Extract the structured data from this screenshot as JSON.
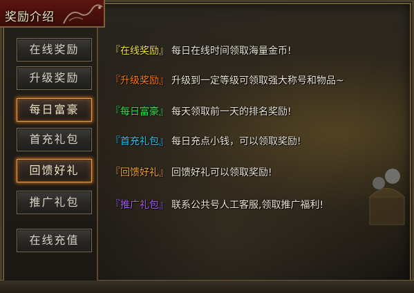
{
  "window": {
    "title": "奖励介绍"
  },
  "menu": [
    {
      "label": "在线奖励",
      "highlighted": false
    },
    {
      "label": "升级奖励",
      "highlighted": false
    },
    {
      "label": "每日富豪",
      "highlighted": true
    },
    {
      "label": "首充礼包",
      "highlighted": false
    },
    {
      "label": "回馈好礼",
      "highlighted": true
    },
    {
      "label": "推广礼包",
      "highlighted": false
    },
    {
      "label": "在线充值",
      "highlighted": false
    }
  ],
  "rewards": [
    {
      "tag": "『在线奖励』",
      "tag_color": "#f2e23a",
      "desc": "每日在线时间领取海量金币!"
    },
    {
      "tag": "『升级奖励』",
      "tag_color": "#ff7a12",
      "desc": "升级到一定等级可领取强大称号和物品~"
    },
    {
      "tag": "『每日富豪』",
      "tag_color": "#39e24a",
      "desc": "每天领取前一天的排名奖励!"
    },
    {
      "tag": "『首充礼包』",
      "tag_color": "#22c8f2",
      "desc": "每日充点小钱，可以领取奖励!"
    },
    {
      "tag": "『回馈好礼』",
      "tag_color": "#f0a23a",
      "desc": "回馈好礼可以领取奖励!"
    },
    {
      "tag": "『推广礼包』",
      "tag_color": "#a65cf2",
      "desc": "联系公共号人工客服,领取推广福利!"
    }
  ]
}
